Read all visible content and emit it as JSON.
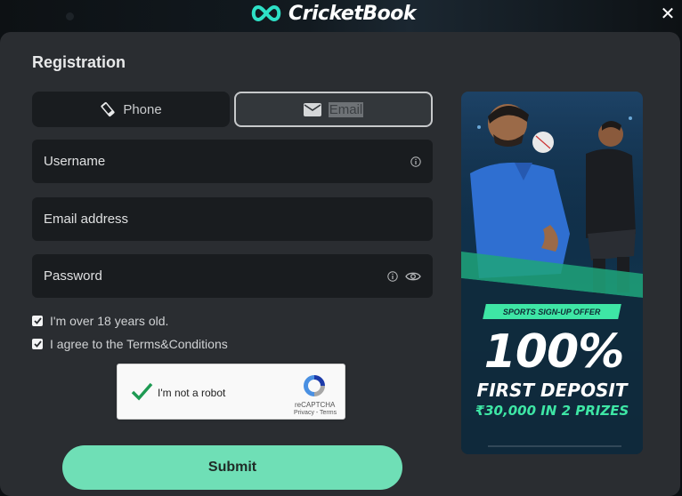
{
  "header": {
    "brand": "CricketBook",
    "close_icon": "close-icon"
  },
  "form": {
    "title": "Registration",
    "tabs": [
      {
        "label": "Phone",
        "icon": "phone-icon",
        "selected": false
      },
      {
        "label": "Email",
        "icon": "envelope-icon",
        "selected": true
      }
    ],
    "fields": {
      "username": {
        "placeholder": "Username",
        "value": "",
        "icon": "info-icon"
      },
      "email": {
        "placeholder": "Email address",
        "value": ""
      },
      "password": {
        "placeholder": "Password",
        "value": "",
        "icons": [
          "info-icon",
          "eye-icon"
        ]
      }
    },
    "checkboxes": [
      {
        "label": "I'm over 18 years old.",
        "checked": true
      },
      {
        "label": "I agree to the Terms&Conditions",
        "checked": true
      }
    ],
    "captcha": {
      "label": "I'm not a robot",
      "checked": true,
      "brand": "reCAPTCHA",
      "links": "Privacy - Terms"
    },
    "submit_label": "Submit"
  },
  "promo": {
    "badge": "SPORTS SIGN-UP OFFER",
    "headline": "100%",
    "subheadline": "FIRST DEPOSIT",
    "prize": "₹30,000 IN 2 PRIZES"
  },
  "colors": {
    "accent": "#6fdfb6",
    "promo_green": "#3ee6a5",
    "modal_bg": "#2a2d31",
    "field_bg": "#191c1f"
  }
}
